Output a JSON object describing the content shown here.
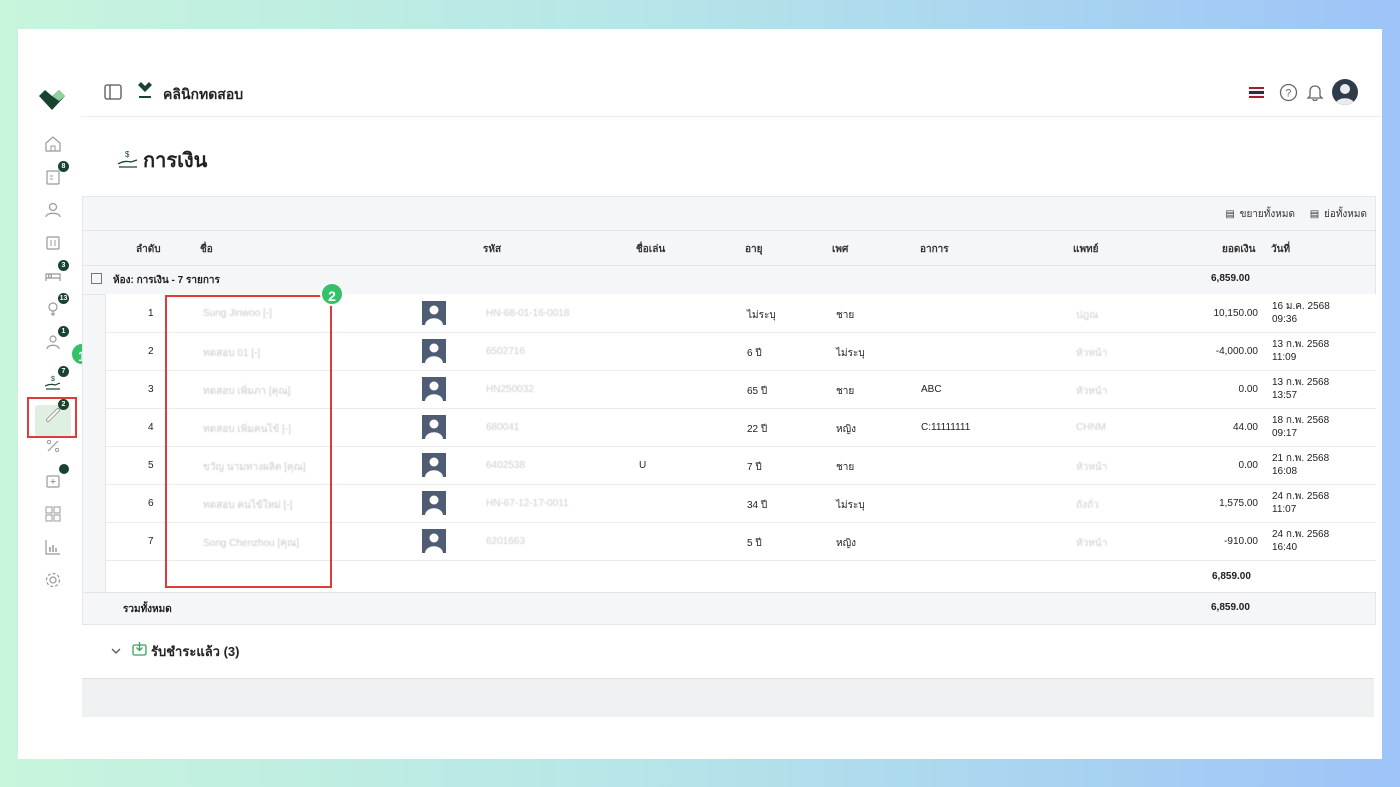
{
  "header": {
    "clinic_name": "คลินิกทดสอบ",
    "language": "Thai",
    "flag_colors": [
      "#a51931",
      "#f4f5f8",
      "#2d2a4a"
    ]
  },
  "sidebar": {
    "active_item": "finance",
    "badges": {
      "appointments": "8",
      "ward": "3",
      "diagnosis": "13",
      "queue": "1",
      "finance": "7",
      "pharmacy": "2"
    }
  },
  "page": {
    "title": "การเงิน"
  },
  "toolbar": {
    "expand_all": "ขยายทั้งหมด",
    "collapse_all": "ย่อทั้งหมด"
  },
  "table": {
    "columns": {
      "index": "ลำดับ",
      "name": "ชื่อ",
      "code": "รหัส",
      "nickname": "ชื่อเล่น",
      "age": "อายุ",
      "sex": "เพศ",
      "symptom": "อาการ",
      "doctor": "แพทย์",
      "amount": "ยอดเงิน",
      "date": "วันที่"
    },
    "group_title": "ห้อง: การเงิน - 7 รายการ",
    "group_total": "6,859.00",
    "rows": [
      {
        "index": "1",
        "name": "Sung Jinwoo [-]",
        "code": "HN-68-01-16-0018",
        "nickname": "",
        "age": "ไม่ระบุ",
        "sex": "ชาย",
        "symptom": "",
        "doctor": "ปฎณ",
        "amount": "10,150.00",
        "date": "16 ม.ค. 2568",
        "time": "09:36"
      },
      {
        "index": "2",
        "name": "ทดสอบ 01 [-]",
        "code": "6502716",
        "nickname": "",
        "age": "6 ปี",
        "sex": "ไม่ระบุ",
        "symptom": "",
        "doctor": "หัวหน้า",
        "amount": "-4,000.00",
        "date": "13 ก.พ. 2568",
        "time": "11:09"
      },
      {
        "index": "3",
        "name": "ทดสอบ เพิ่มภา [คุณ]",
        "code": "HN250032",
        "nickname": "",
        "age": "65 ปี",
        "sex": "ชาย",
        "symptom": "ABC",
        "doctor": "หัวหน้า",
        "amount": "0.00",
        "date": "13 ก.พ. 2568",
        "time": "13:57"
      },
      {
        "index": "4",
        "name": "ทดสอบ เพิ่มคนไข้ [-]",
        "code": "680041",
        "nickname": "",
        "age": "22 ปี",
        "sex": "หญิง",
        "symptom": "C:11111111",
        "doctor": "CHNM",
        "amount": "44.00",
        "date": "18 ก.พ. 2568",
        "time": "09:17"
      },
      {
        "index": "5",
        "name": "ขวัญ นามทางผลิต [คุณ]",
        "code": "6402538",
        "nickname": "U",
        "age": "7 ปี",
        "sex": "ชาย",
        "symptom": "",
        "doctor": "หัวหน้า",
        "amount": "0.00",
        "date": "21 ก.พ. 2568",
        "time": "16:08"
      },
      {
        "index": "6",
        "name": "ทดสอบ คนไข้ใหม่ [-]",
        "code": "HN-67-12-17-0011",
        "nickname": "",
        "age": "34 ปี",
        "sex": "ไม่ระบุ",
        "symptom": "",
        "doctor": "ถังถั่ว",
        "amount": "1,575.00",
        "date": "24 ก.พ. 2568",
        "time": "11:07"
      },
      {
        "index": "7",
        "name": "Song Chenzhou [คุณ]",
        "code": "6201663",
        "nickname": "",
        "age": "5 ปี",
        "sex": "หญิง",
        "symptom": "",
        "doctor": "หัวหน้า",
        "amount": "-910.00",
        "date": "24 ก.พ. 2568",
        "time": "16:40"
      }
    ],
    "subtotal": "6,859.00",
    "grand_total_label": "รวมทั้งหมด",
    "grand_total": "6,859.00"
  },
  "paid_section": {
    "label": "รับชำระแล้ว (3)"
  },
  "callouts": [
    "1",
    "2"
  ],
  "colors": {
    "brand_green": "#17432f",
    "accent_green": "#35c06a",
    "highlight_red": "#e03b3b"
  }
}
